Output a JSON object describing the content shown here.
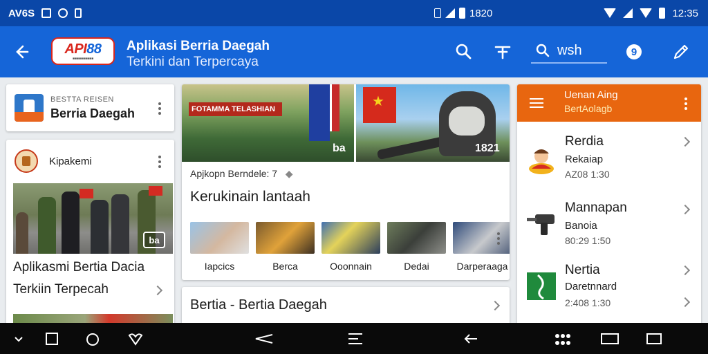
{
  "status_bar": {
    "left_text": "AV6S",
    "middle_text": "1820",
    "time": "12:35"
  },
  "app_bar": {
    "logo_text_a": "API",
    "logo_text_b": "88",
    "title": "Aplikasi Berria Daegah",
    "subtitle": "Terkini dan Terpercaya",
    "search_text": "wsh",
    "help_glyph": "9"
  },
  "news_card": {
    "subtitle": "BESTTA REISEN",
    "title": "Berria Daegah"
  },
  "feature_card": {
    "org_name": "Kipakemi",
    "photo_badge": "ba",
    "caption_line1": "Aplikasmi Bertia Dacia",
    "caption_line2": "Terkiin Terpecah"
  },
  "main_card": {
    "hero_banner": "FOTAMMA TELASHIAN",
    "hero_left_tag": "ba",
    "hero_right_tag": "1821",
    "source": "Apjkopn Berndele: 7",
    "headline": "Kerukinain lantaah",
    "thumbnails": [
      {
        "label": "Iapcics",
        "color": "#8ab4d8"
      },
      {
        "label": "Berca",
        "color": "#c98a3a"
      },
      {
        "label": "Ooonnain",
        "color": "#4a6fa8"
      },
      {
        "label": "Dedai",
        "color": "#5e6d52"
      },
      {
        "label": "Darperaaga",
        "color": "#4f5e7a"
      }
    ]
  },
  "bottom_card": {
    "title": "Bertia - Bertia Daegah"
  },
  "side_panel": {
    "header_line1": "Uenan Aing",
    "header_line2": "BertAolagb",
    "items": [
      {
        "name": "Rerdia",
        "sub": "Rekaiap",
        "time": "AZ08 1:30",
        "icon": "person-icon"
      },
      {
        "name": "Mannapan",
        "sub": "Banoia",
        "time": "80:29 1:50",
        "icon": "drill-icon"
      },
      {
        "name": "Nertia",
        "sub": "Daretnnard",
        "time": "2:408 1:30",
        "icon": "map-icon"
      }
    ]
  },
  "colors": {
    "status_bar": "#0a47a8",
    "app_bar": "#1565d8",
    "side_header": "#e8660f",
    "nav_bar": "#0a0a0a"
  }
}
